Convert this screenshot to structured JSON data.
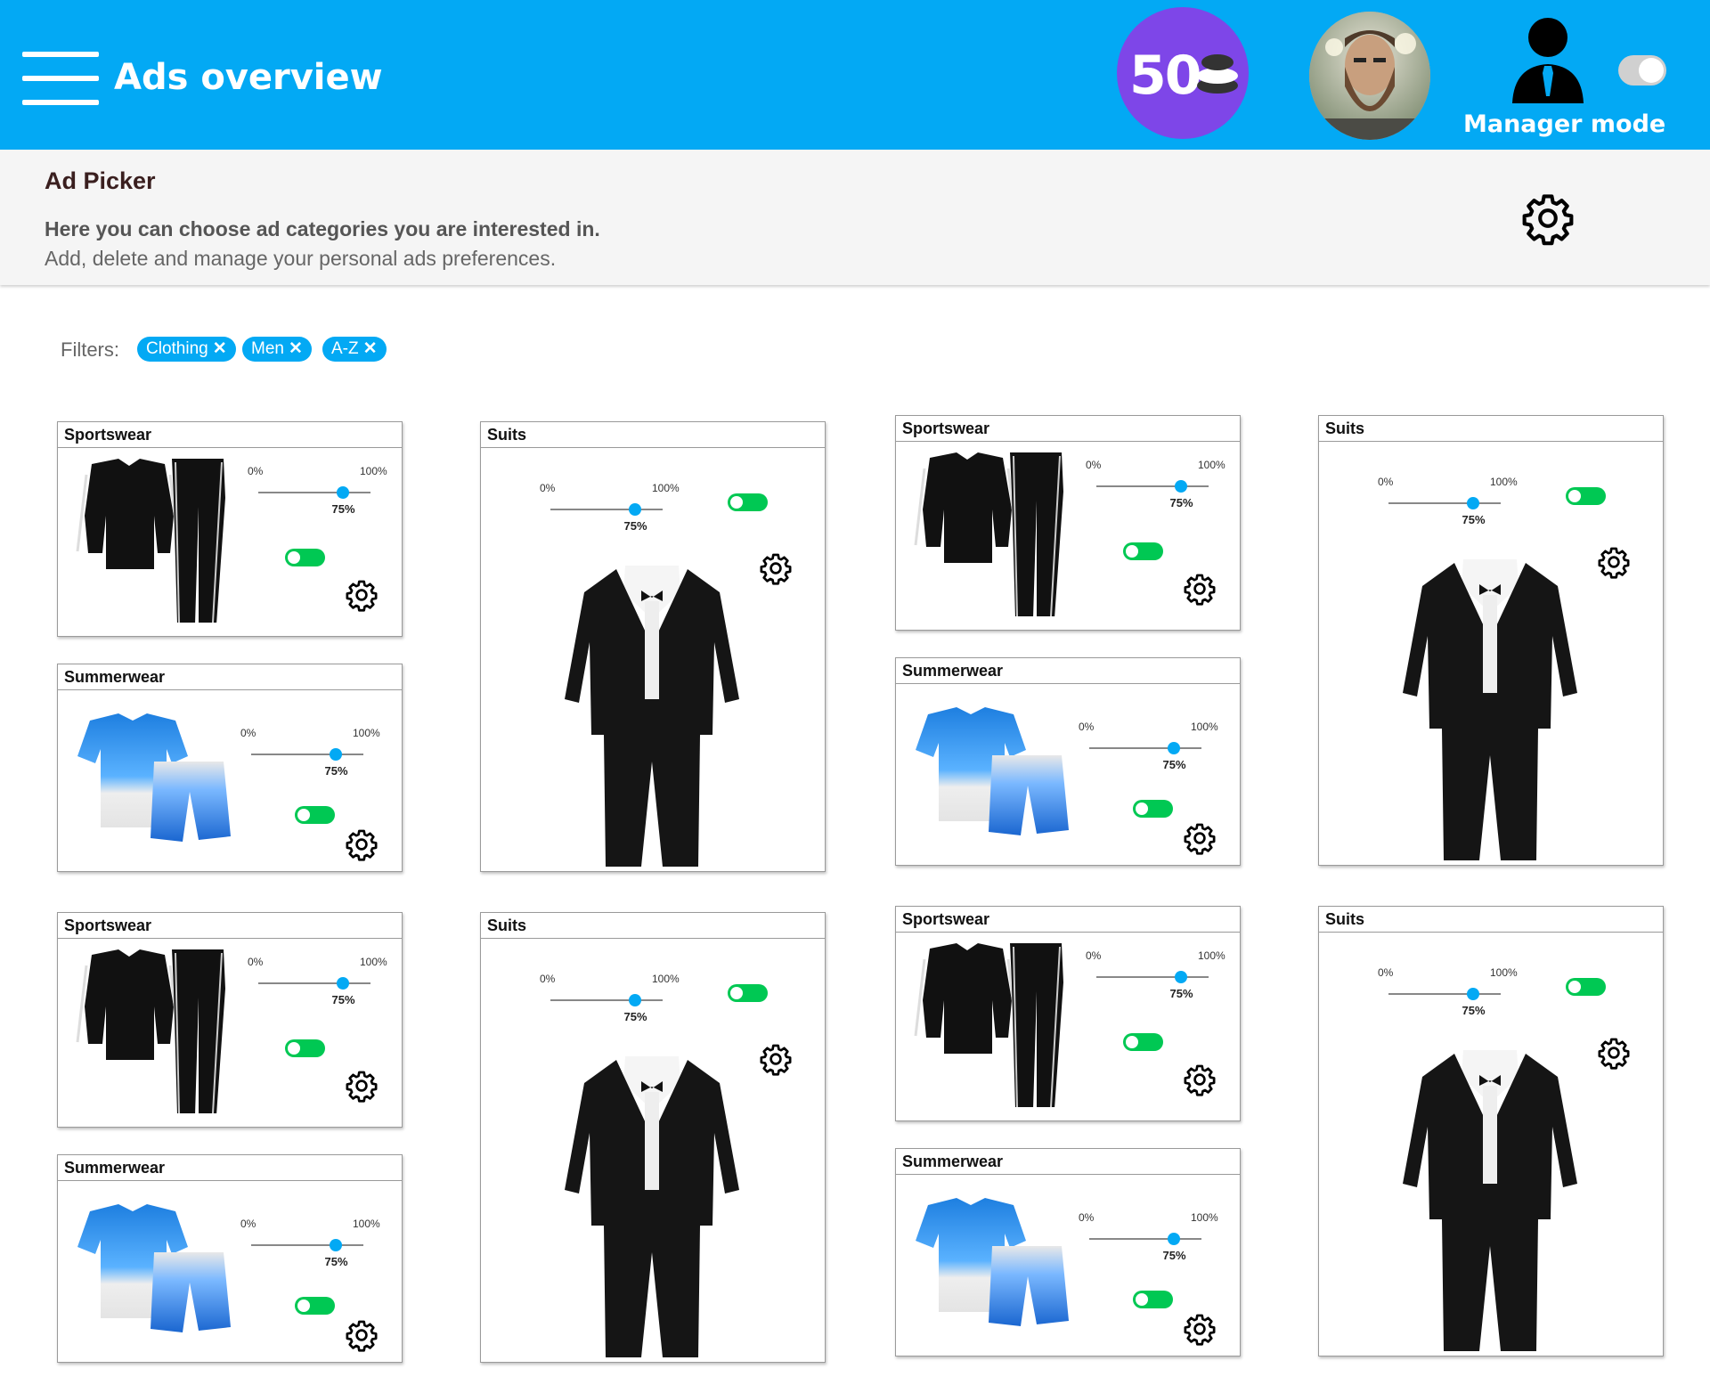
{
  "app": {
    "title": "Ads overview",
    "coins": "50",
    "manager_mode_label": "Manager mode",
    "manager_mode_on": false
  },
  "ad_picker": {
    "title": "Ad Picker",
    "description_bold": "Here you can choose ad categories you are interested in.",
    "description": "Add, delete and manage your personal ads preferences."
  },
  "filters": {
    "label": "Filters:",
    "chips": [
      "Clothing",
      "Men",
      "A-Z"
    ]
  },
  "cards": [
    {
      "title": "Sportswear",
      "min_label": "0%",
      "max_label": "100%",
      "value_label": "75%",
      "value": 0.75,
      "enabled": true
    },
    {
      "title": "Summerwear",
      "min_label": "0%",
      "max_label": "100%",
      "value_label": "75%",
      "value": 0.75,
      "enabled": true
    },
    {
      "title": "Suits",
      "min_label": "0%",
      "max_label": "100%",
      "value_label": "75%",
      "value": 0.75,
      "enabled": true
    },
    {
      "title": "Sportswear",
      "min_label": "0%",
      "max_label": "100%",
      "value_label": "75%",
      "value": 0.75,
      "enabled": true
    },
    {
      "title": "Summerwear",
      "min_label": "0%",
      "max_label": "100%",
      "value_label": "75%",
      "value": 0.75,
      "enabled": true
    },
    {
      "title": "Suits",
      "min_label": "0%",
      "max_label": "100%",
      "value_label": "75%",
      "value": 0.75,
      "enabled": true
    },
    {
      "title": "Sportswear",
      "min_label": "0%",
      "max_label": "100%",
      "value_label": "75%",
      "value": 0.75,
      "enabled": true
    },
    {
      "title": "Summerwear",
      "min_label": "0%",
      "max_label": "100%",
      "value_label": "75%",
      "value": 0.75,
      "enabled": true
    },
    {
      "title": "Suits",
      "min_label": "0%",
      "max_label": "100%",
      "value_label": "75%",
      "value": 0.75,
      "enabled": true
    },
    {
      "title": "Sportswear",
      "min_label": "0%",
      "max_label": "100%",
      "value_label": "75%",
      "value": 0.75,
      "enabled": true
    },
    {
      "title": "Summerwear",
      "min_label": "0%",
      "max_label": "100%",
      "value_label": "75%",
      "value": 0.75,
      "enabled": true
    },
    {
      "title": "Suits",
      "min_label": "0%",
      "max_label": "100%",
      "value_label": "75%",
      "value": 0.75,
      "enabled": true
    }
  ],
  "colors": {
    "header": "#03a9f4",
    "coin_badge": "#7e46e8",
    "toggle_on": "#00c853",
    "slider_knob": "#03a9f4"
  },
  "icons": [
    "menu-icon",
    "coins-icon",
    "avatar",
    "manager-user-icon",
    "gear-icon"
  ]
}
